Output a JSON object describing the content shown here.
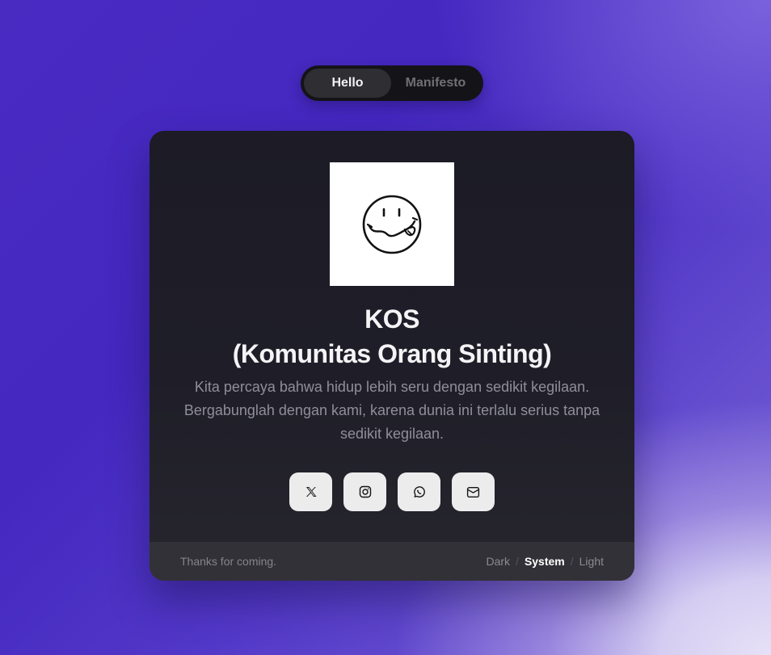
{
  "nav": {
    "tabs": [
      {
        "label": "Hello",
        "active": true
      },
      {
        "label": "Manifesto",
        "active": false
      }
    ]
  },
  "card": {
    "avatar_icon": "smiley-face-icon",
    "title_line1": "KOS",
    "title_line2": "(Komunitas Orang Sinting)",
    "description": "Kita percaya bahwa hidup lebih seru dengan sedikit kegilaan. Bergabunglah dengan kami, karena dunia ini terlalu serius tanpa sedikit kegilaan.",
    "socials": [
      {
        "icon": "x-twitter-icon"
      },
      {
        "icon": "instagram-icon"
      },
      {
        "icon": "whatsapp-icon"
      },
      {
        "icon": "mail-icon"
      }
    ]
  },
  "footer": {
    "thanks": "Thanks for coming.",
    "theme_options": [
      "Dark",
      "System",
      "Light"
    ],
    "theme_selected": "System",
    "separator": "/"
  },
  "colors": {
    "background_start": "#4428c0",
    "background_end": "#e6e1f7",
    "card_bg": "#1c1b26",
    "footer_bg": "#323137",
    "button_bg": "#ececed"
  }
}
